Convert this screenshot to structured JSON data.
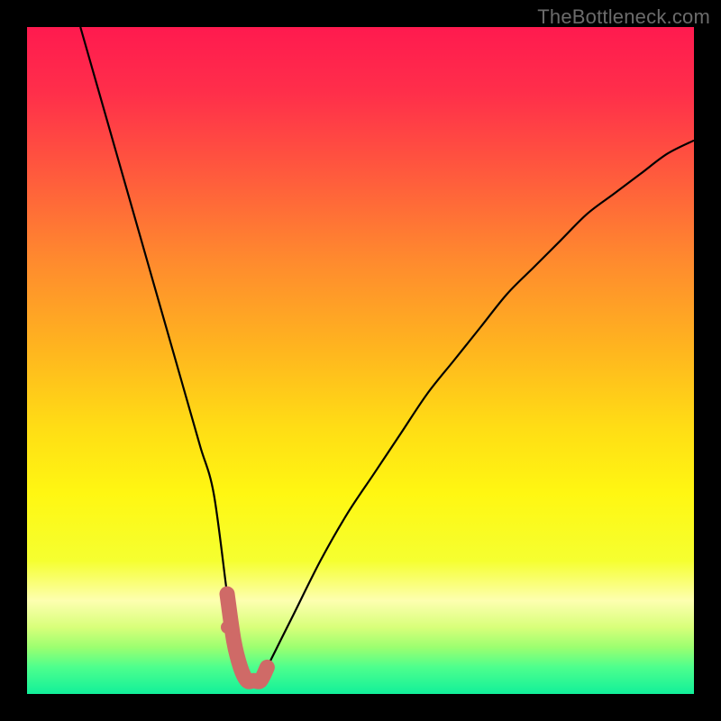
{
  "watermark": "TheBottleneck.com",
  "chart_data": {
    "type": "line",
    "title": "",
    "xlabel": "",
    "ylabel": "",
    "xlim": [
      0,
      100
    ],
    "ylim": [
      0,
      100
    ],
    "grid": false,
    "legend": false,
    "series": [
      {
        "name": "bottleneck-curve",
        "x": [
          8,
          10,
          12,
          14,
          16,
          18,
          20,
          22,
          24,
          26,
          28,
          30,
          31,
          32,
          33,
          34,
          35,
          36,
          38,
          40,
          44,
          48,
          52,
          56,
          60,
          64,
          68,
          72,
          76,
          80,
          84,
          88,
          92,
          96,
          100
        ],
        "y": [
          100,
          93,
          86,
          79,
          72,
          65,
          58,
          51,
          44,
          37,
          30,
          15,
          8,
          4,
          2,
          2,
          2,
          4,
          8,
          12,
          20,
          27,
          33,
          39,
          45,
          50,
          55,
          60,
          64,
          68,
          72,
          75,
          78,
          81,
          83
        ]
      }
    ],
    "annotations": [
      {
        "name": "trough-highlight",
        "type": "segment",
        "x_range": [
          30,
          37
        ],
        "y": 3,
        "color": "#cf6a67"
      },
      {
        "name": "trough-dot",
        "type": "point",
        "x": 30,
        "y": 10,
        "color": "#cf6a67"
      }
    ],
    "background_gradient": {
      "direction": "vertical",
      "stops": [
        {
          "position": 0.0,
          "color": "#ff1a4f"
        },
        {
          "position": 0.1,
          "color": "#ff2f4a"
        },
        {
          "position": 0.22,
          "color": "#ff5a3d"
        },
        {
          "position": 0.35,
          "color": "#ff8a2e"
        },
        {
          "position": 0.48,
          "color": "#ffb41f"
        },
        {
          "position": 0.6,
          "color": "#ffdd15"
        },
        {
          "position": 0.7,
          "color": "#fff712"
        },
        {
          "position": 0.8,
          "color": "#f5ff30"
        },
        {
          "position": 0.86,
          "color": "#fdffb0"
        },
        {
          "position": 0.9,
          "color": "#d8ff7a"
        },
        {
          "position": 0.93,
          "color": "#9cff70"
        },
        {
          "position": 0.96,
          "color": "#4dff8d"
        },
        {
          "position": 1.0,
          "color": "#12f09a"
        }
      ]
    }
  }
}
